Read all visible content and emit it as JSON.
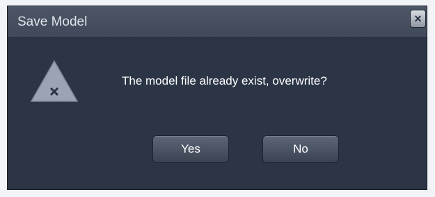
{
  "dialog": {
    "title": "Save Model",
    "close_label": "×",
    "icon": "warning-triangle-icon",
    "message": "The model file already exist, overwrite?",
    "buttons": {
      "yes_label": "Yes",
      "no_label": "No"
    }
  },
  "colors": {
    "dialog_bg": "#2b3546",
    "titlebar_bg": "#454f5f",
    "text": "#ffffff",
    "icon_fill": "#9aa4b2"
  }
}
